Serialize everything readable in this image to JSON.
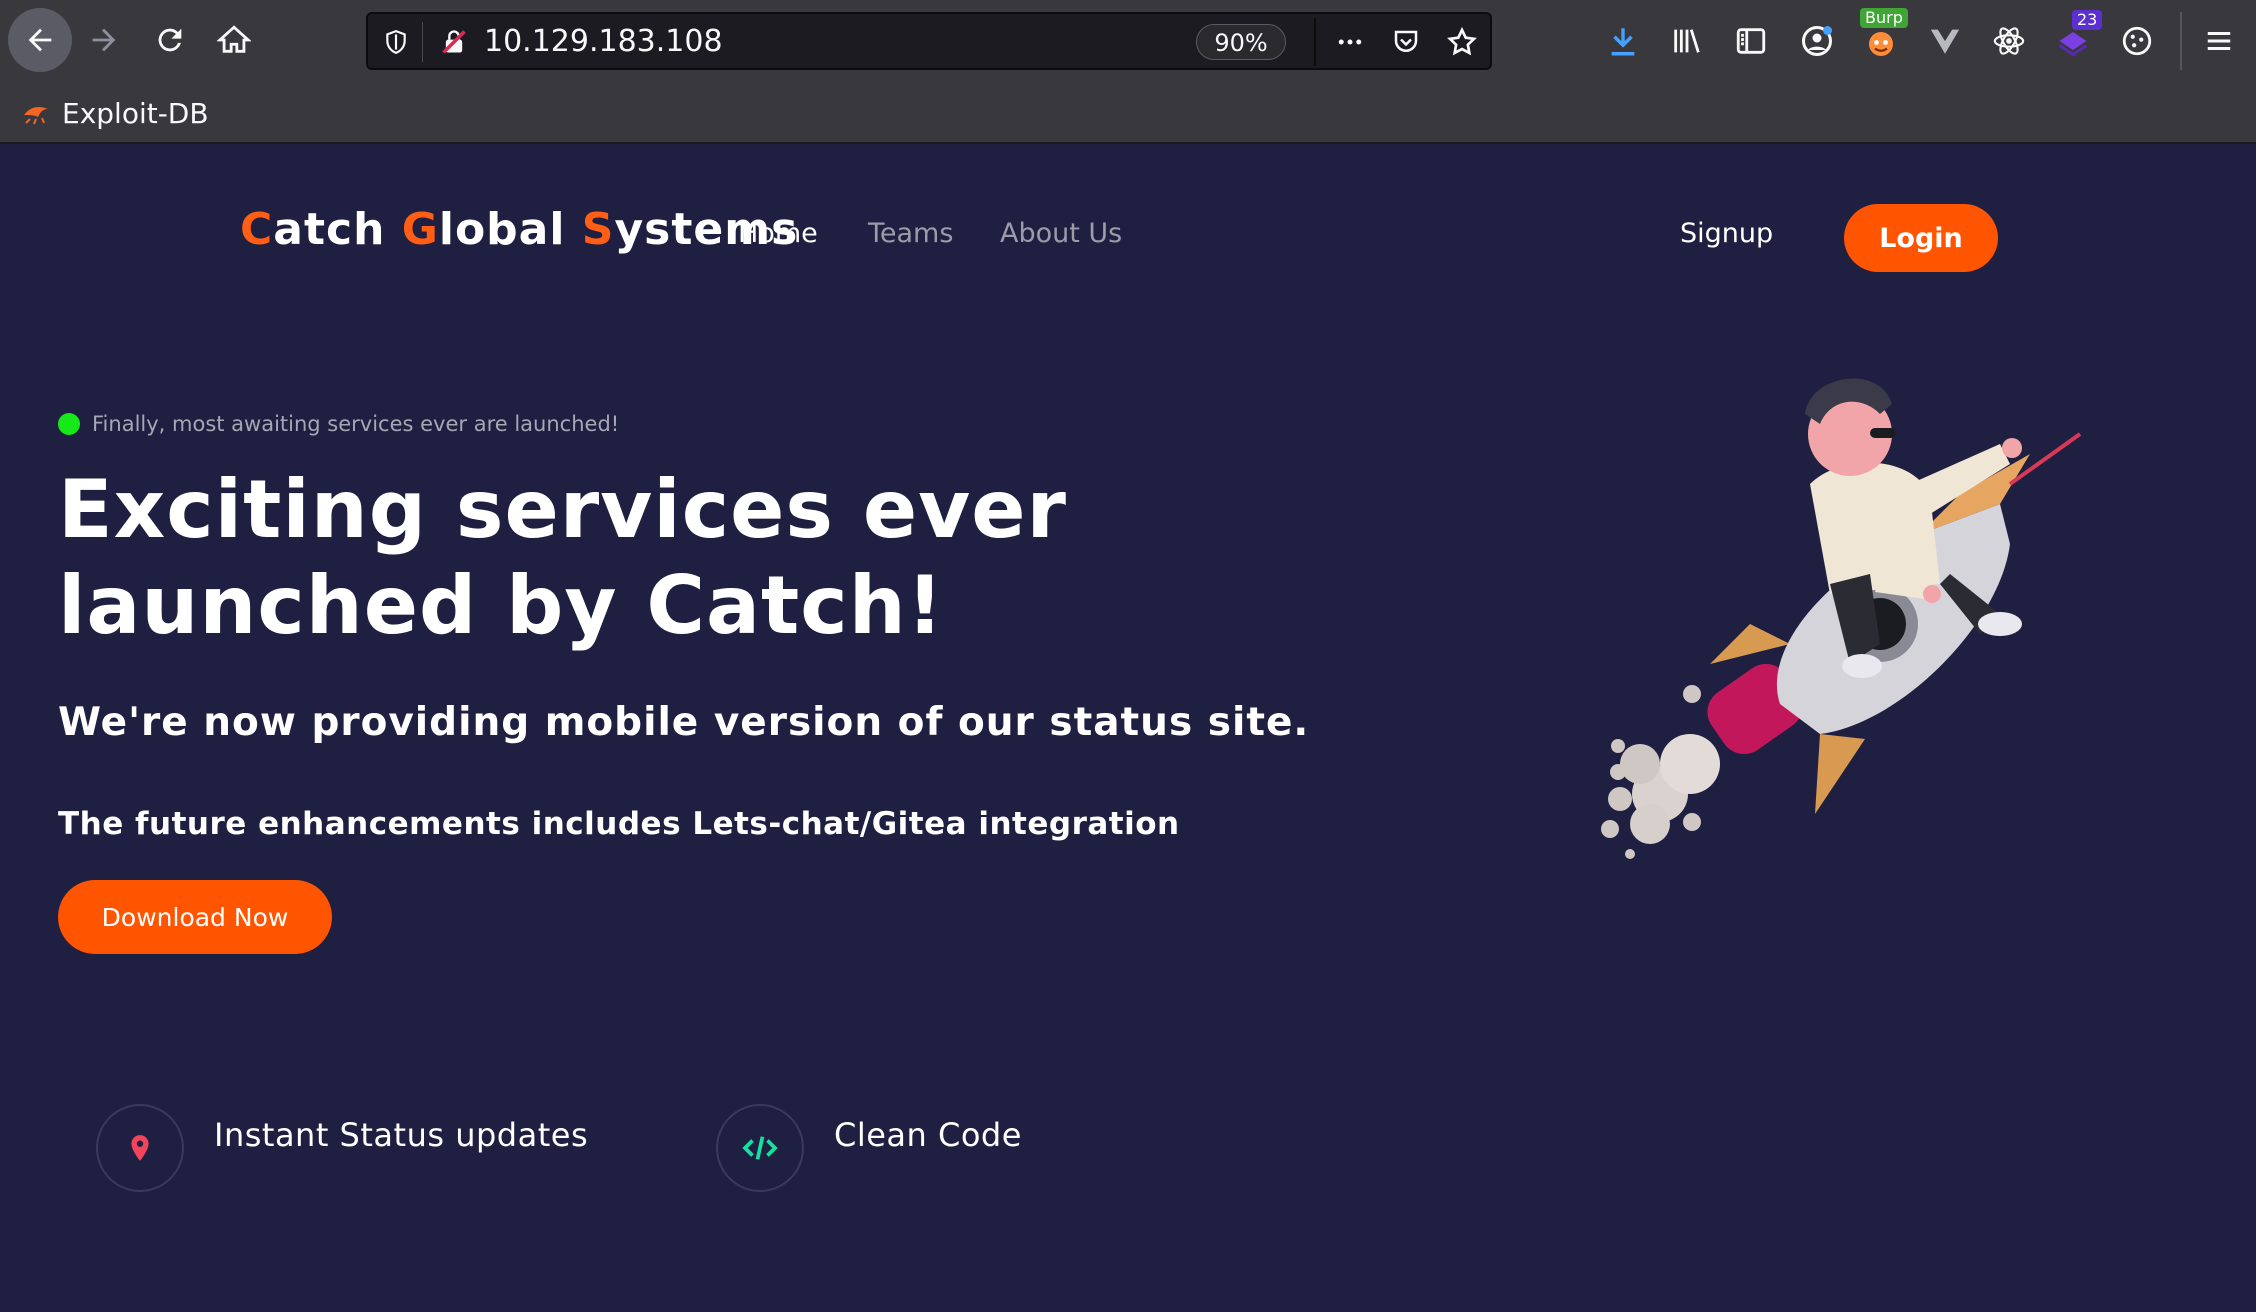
{
  "browser": {
    "url": "10.129.183.108",
    "zoom": "90%",
    "bookmarks": [
      {
        "label": "Exploit-DB"
      }
    ],
    "extensions": {
      "burp_badge": "Burp",
      "notif_count": "23"
    }
  },
  "site": {
    "brand": {
      "c1": "C",
      "r1": "atch ",
      "c2": "G",
      "r2": "lobal ",
      "c3": "S",
      "r3": "ystems"
    },
    "nav": {
      "home": "Home",
      "teams": "Teams",
      "about": "About Us"
    },
    "signup": "Signup",
    "login": "Login"
  },
  "hero": {
    "status": "Finally, most awaiting services ever are launched!",
    "title": "Exciting services ever launched by Catch!",
    "subtitle": "We're now providing mobile version of our status site.",
    "note": "The future enhancements includes Lets-chat/Gitea integration",
    "cta": "Download Now"
  },
  "features": [
    {
      "label": "Instant Status updates",
      "icon": "map-pin-icon"
    },
    {
      "label": "Clean Code",
      "icon": "code-icon"
    }
  ],
  "colors": {
    "accent": "#ff5400",
    "background": "#1f1f41",
    "status_dot": "#17e817",
    "code_icon": "#14e0a0",
    "pin_icon": "#f2455b"
  }
}
